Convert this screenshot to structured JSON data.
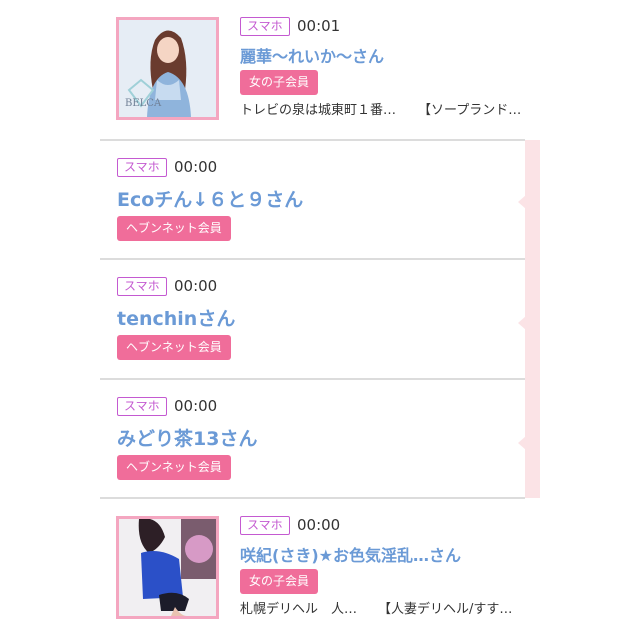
{
  "items": [
    {
      "device": "スマホ",
      "time": "00:01",
      "name": "麗華〜れいか〜さん",
      "member_type": "女の子会員",
      "desc_left": "トレビの泉は城東町１番…",
      "desc_right": "【ソープランド…",
      "thumb_icon": "woman-photo-thumbnail",
      "thumb_logo": "BELCA"
    },
    {
      "device": "スマホ",
      "time": "00:00",
      "name": "Ecoチん↓６と９さん",
      "member_type": "ヘブンネット会員"
    },
    {
      "device": "スマホ",
      "time": "00:00",
      "name": "tenchinさん",
      "member_type": "ヘブンネット会員"
    },
    {
      "device": "スマホ",
      "time": "00:00",
      "name": "みどり茶13さん",
      "member_type": "ヘブンネット会員"
    },
    {
      "device": "スマホ",
      "time": "00:00",
      "name": "咲紀(さき)★お色気淫乱…さん",
      "member_type": "女の子会員",
      "desc_left": "札幌デリヘル　人…",
      "desc_right": "【人妻デリヘル/すす…",
      "thumb_icon": "woman-photo-thumbnail"
    }
  ],
  "colors": {
    "badge": "#c45ad1",
    "tag": "#f06d9a",
    "name": "#6b9ad6",
    "thumb_border": "#f4a6c0",
    "stripe": "#fbe3e6"
  }
}
